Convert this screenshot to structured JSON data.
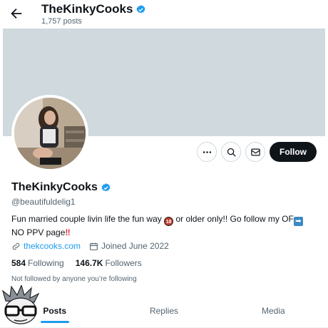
{
  "header": {
    "name": "TheKinkyCooks",
    "post_count": "1,757 posts"
  },
  "actions": {
    "more_icon": "more-icon",
    "search_icon": "search-icon",
    "message_icon": "mail-icon",
    "follow_label": "Follow"
  },
  "profile": {
    "name": "TheKinkyCooks",
    "handle": "@beautifuldelig1",
    "bio_text_1": "Fun married couple livin life the fun way ",
    "bio_emoji_18": "18",
    "bio_text_2": " or older only!! Go follow my OF",
    "bio_emoji_arrow": "➡",
    "bio_text_3": " NO PPV page",
    "bio_emoji_bang": "‼",
    "website": "thekcooks.com",
    "joined": "Joined June 2022"
  },
  "stats": {
    "following_count": "584",
    "following_label": "Following",
    "followers_count": "146.7K",
    "followers_label": "Followers"
  },
  "note": "Not followed by anyone you’re following",
  "tabs": [
    {
      "label": "Posts"
    },
    {
      "label": "Replies"
    },
    {
      "label": "Media"
    }
  ],
  "colors": {
    "accent": "#1d9bf0",
    "text": "#0f1419",
    "muted": "#536471",
    "banner": "#cfd9de"
  }
}
